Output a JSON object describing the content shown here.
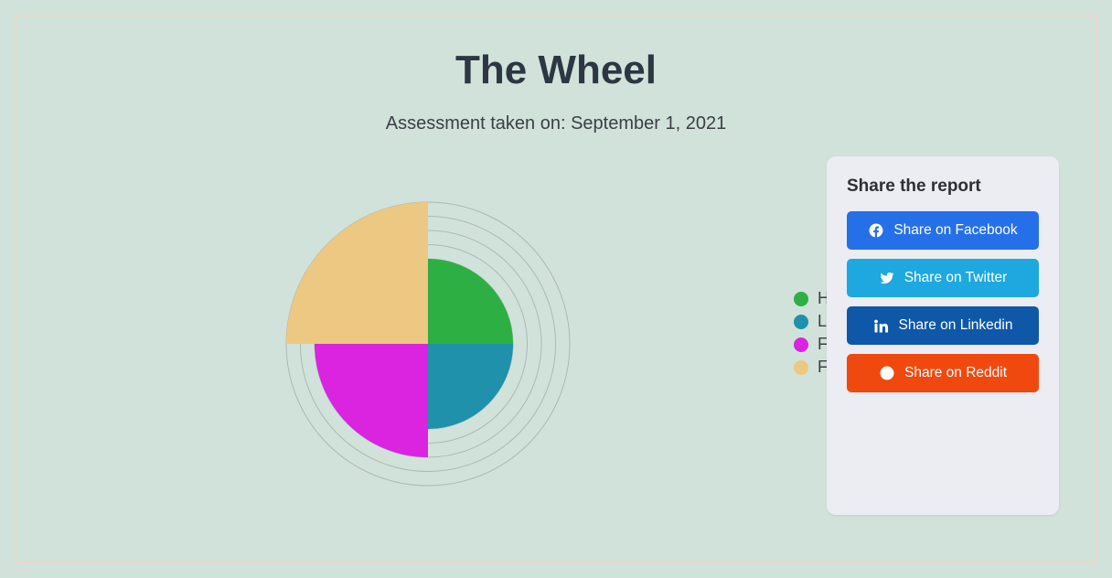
{
  "header": {
    "title": "The Wheel",
    "subtitle": "Assessment taken on: September 1, 2021"
  },
  "share": {
    "panel_title": "Share the report",
    "facebook": "Share on Facebook",
    "twitter": "Share on Twitter",
    "linkedin": "Share on Linkedin",
    "reddit": "Share on Reddit"
  },
  "colors": {
    "health": "#2eaf43",
    "life": "#1f91ab",
    "fun": "#da24e0",
    "friends": "#ecc882"
  },
  "chart_data": {
    "type": "pie",
    "title": "The Wheel",
    "categories": [
      "Health",
      "Life",
      "Fun",
      "Friends"
    ],
    "values": [
      6,
      6,
      8,
      10
    ],
    "ylim": [
      0,
      10
    ],
    "note": "Polar-area style: each quadrant spans 90°; radius encodes value on 0–10 scale; background rings at 6, 7, 8, 9, 10."
  }
}
